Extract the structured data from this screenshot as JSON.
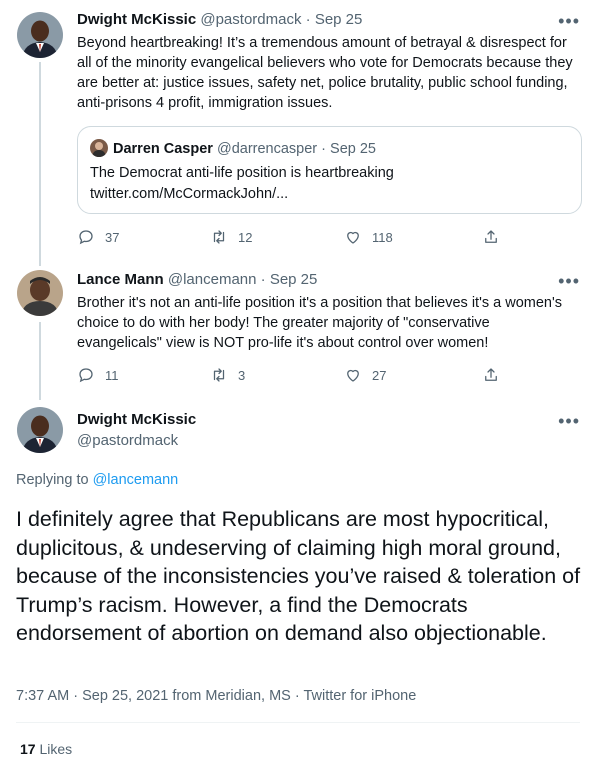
{
  "tweets": [
    {
      "name": "Dwight McKissic",
      "handle": "@pastordmack",
      "sep": "·",
      "date": "Sep 25",
      "text": "Beyond heartbreaking! It’s a tremendous amount of betrayal & disrespect for all of the minority evangelical believers who vote for Democrats because they are better at: justice issues, safety net, police brutality, public school funding, anti-prisons 4 profit, immigration issues.",
      "quote": {
        "name": "Darren Casper",
        "handle": "@darrencasper",
        "sep": "·",
        "date": "Sep 25",
        "line1": "The Democrat anti-life position is heartbreaking",
        "line2": "twitter.com/McCormackJohn/..."
      },
      "replies": "37",
      "retweets": "12",
      "likes": "118"
    },
    {
      "name": "Lance Mann",
      "handle": "@lancemann",
      "sep": "·",
      "date": "Sep 25",
      "text": "Brother it's not an anti-life position it's a position that believes it's a women's choice to do with her body! The greater majority of \"conservative evangelicals\" view is NOT pro-life it's about control over women!",
      "replies": "11",
      "retweets": "3",
      "likes": "27"
    }
  ],
  "main": {
    "name": "Dwight McKissic",
    "handle": "@pastordmack",
    "replying_prefix": "Replying to ",
    "replying_to": "@lancemann",
    "text": "I definitely agree that Republicans are most hypocritical, duplicitous, & undeserving of claiming high moral ground, because of the inconsistencies you’ve raised & toleration of Trump’s racism. However, a find the Democrats endorsement of abortion on demand also objectionable.",
    "meta": "7:37 AM · Sep 25, 2021 from Meridian, MS · Twitter for iPhone",
    "likes_count": "17",
    "likes_label": "Likes"
  },
  "more_glyph": "•••",
  "icons": [
    "reply-icon",
    "retweet-icon",
    "like-icon",
    "share-icon",
    "more-icon"
  ],
  "colors": {
    "link": "#1d9bf0",
    "muted": "#536471",
    "text": "#0f1419",
    "border": "#cfd9de"
  }
}
